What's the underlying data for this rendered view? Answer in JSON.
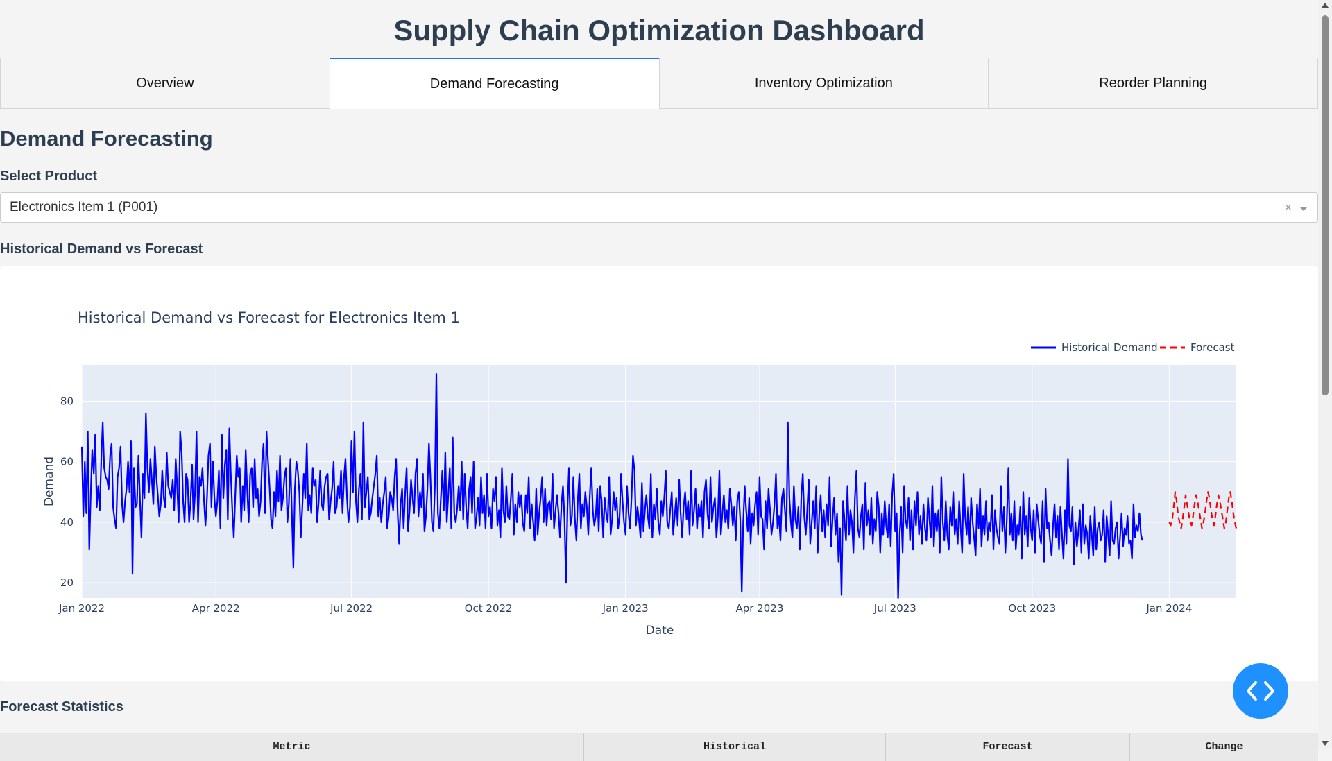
{
  "header": {
    "title": "Supply Chain Optimization Dashboard"
  },
  "tabs": [
    {
      "label": "Overview",
      "active": false
    },
    {
      "label": "Demand Forecasting",
      "active": true
    },
    {
      "label": "Inventory Optimization",
      "active": false
    },
    {
      "label": "Reorder Planning",
      "active": false
    }
  ],
  "main": {
    "section_title": "Demand Forecasting",
    "select_label": "Select Product",
    "product_select": {
      "value": "Electronics Item 1 (P001)",
      "clear_icon": "×",
      "dropdown_icon": "chevron-down-icon"
    },
    "chart_heading": "Historical Demand vs Forecast",
    "stats_heading": "Forecast Statistics",
    "stats_table": {
      "columns": [
        "Metric",
        "Historical",
        "Forecast",
        "Change"
      ]
    }
  },
  "fab": {
    "icon": "code-brackets-icon",
    "color": "#1e90ff"
  },
  "colors": {
    "accent": "#1975fa",
    "historical": "#0000ff",
    "forecast": "#ff0000",
    "plot_bg": "#e5ecf6"
  },
  "chart_data": {
    "type": "line",
    "title": "Historical Demand vs Forecast for Electronics Item 1",
    "xlabel": "Date",
    "ylabel": "Demand",
    "xlim": [
      "2022-01-01",
      "2024-02-15"
    ],
    "ylim": [
      15,
      92
    ],
    "x_ticks": [
      "Jan 2022",
      "Apr 2022",
      "Jul 2022",
      "Oct 2022",
      "Jan 2023",
      "Apr 2023",
      "Jul 2023",
      "Oct 2023",
      "Jan 2024"
    ],
    "y_ticks": [
      20,
      40,
      60,
      80
    ],
    "grid": true,
    "legend": "top-right",
    "series": [
      {
        "name": "Historical Demand",
        "style": "solid",
        "x_start": "2022-01-01",
        "x_end": "2023-12-31",
        "frequency": "daily",
        "values": [
          65,
          42,
          60,
          43,
          70,
          31,
          50,
          64,
          56,
          69,
          45,
          52,
          44,
          60,
          73,
          58,
          55,
          54,
          51,
          62,
          66,
          45,
          41,
          38,
          55,
          58,
          65,
          46,
          40,
          47,
          51,
          60,
          50,
          67,
          23,
          58,
          45,
          46,
          62,
          48,
          35,
          56,
          48,
          76,
          58,
          50,
          61,
          54,
          46,
          65,
          55,
          49,
          42,
          46,
          57,
          48,
          45,
          63,
          52,
          50,
          48,
          54,
          44,
          61,
          52,
          40,
          70,
          63,
          47,
          40,
          56,
          54,
          40,
          47,
          59,
          41,
          50,
          70,
          40,
          55,
          52,
          58,
          47,
          39,
          48,
          62,
          66,
          45,
          60,
          48,
          42,
          47,
          57,
          38,
          69,
          48,
          59,
          64,
          41,
          71,
          56,
          44,
          35,
          49,
          62,
          55,
          58,
          40,
          52,
          44,
          64,
          51,
          40,
          56,
          58,
          45,
          61,
          48,
          51,
          42,
          47,
          60,
          66,
          43,
          70,
          60,
          52,
          41,
          38,
          50,
          42,
          57,
          47,
          62,
          44,
          48,
          55,
          58,
          40,
          46,
          61,
          43,
          25,
          51,
          60,
          57,
          50,
          35,
          45,
          56,
          48,
          66,
          44,
          49,
          43,
          58,
          52,
          54,
          40,
          47,
          57,
          46,
          44,
          52,
          55,
          56,
          41,
          47,
          51,
          60,
          43,
          45,
          52,
          48,
          57,
          43,
          55,
          61,
          48,
          40,
          45,
          67,
          50,
          70,
          47,
          40,
          51,
          56,
          41,
          73,
          45,
          50,
          55,
          41,
          43,
          48,
          52,
          56,
          62,
          42,
          48,
          40,
          46,
          50,
          55,
          38,
          42,
          50,
          48,
          44,
          55,
          61,
          43,
          33,
          46,
          51,
          38,
          49,
          58,
          37,
          44,
          54,
          48,
          43,
          56,
          61,
          42,
          50,
          45,
          56,
          37,
          42,
          51,
          66,
          55,
          40,
          37,
          52,
          89,
          43,
          38,
          48,
          57,
          44,
          63,
          40,
          49,
          58,
          38,
          68,
          43,
          40,
          45,
          52,
          44,
          60,
          41,
          56,
          45,
          38,
          51,
          55,
          43,
          60,
          38,
          42,
          48,
          39,
          55,
          43,
          49,
          38,
          56,
          42,
          45,
          38,
          51,
          47,
          55,
          39,
          44,
          35,
          58,
          44,
          40,
          52,
          42,
          41,
          48,
          56,
          36,
          46,
          40,
          50,
          45,
          49,
          40,
          37,
          49,
          43,
          55,
          38,
          46,
          40,
          34,
          51,
          36,
          43,
          48,
          55,
          40,
          51,
          39,
          46,
          47,
          41,
          56,
          38,
          44,
          49,
          43,
          35,
          46,
          52,
          41,
          20,
          45,
          58,
          39,
          42,
          55,
          41,
          34,
          48,
          56,
          38,
          46,
          42,
          50,
          45,
          36,
          49,
          58,
          44,
          39,
          42,
          51,
          37,
          52,
          47,
          35,
          48,
          43,
          40,
          55,
          36,
          41,
          50,
          44,
          48,
          38,
          42,
          56,
          47,
          40,
          36,
          52,
          43,
          38,
          48,
          62,
          57,
          39,
          45,
          41,
          35,
          53,
          37,
          44,
          49,
          42,
          38,
          56,
          35,
          46,
          41,
          51,
          40,
          36,
          47,
          42,
          48,
          57,
          40,
          38,
          44,
          50,
          36,
          42,
          48,
          39,
          54,
          43,
          35,
          45,
          50,
          41,
          47,
          36,
          57,
          39,
          44,
          51,
          38,
          46,
          42,
          47,
          35,
          50,
          54,
          43,
          38,
          55,
          40,
          45,
          48,
          35,
          42,
          57,
          36,
          43,
          49,
          40,
          44,
          38,
          51,
          46,
          39,
          45,
          34,
          47,
          50,
          41,
          17,
          40,
          52,
          44,
          37,
          48,
          33,
          43,
          39,
          46,
          50,
          36,
          55,
          42,
          41,
          31,
          47,
          38,
          51,
          44,
          36,
          40,
          46,
          56,
          38,
          42,
          34,
          48,
          51,
          44,
          37,
          73,
          48,
          40,
          35,
          52,
          41,
          38,
          45,
          31,
          48,
          56,
          42,
          36,
          44,
          54,
          33,
          40,
          47,
          38,
          52,
          30,
          42,
          49,
          37,
          44,
          35,
          46,
          39,
          55,
          32,
          41,
          48,
          36,
          43,
          27,
          38,
          16,
          47,
          41,
          34,
          52,
          36,
          44,
          40,
          30,
          48,
          57,
          38,
          35,
          42,
          46,
          31,
          53,
          39,
          44,
          36,
          48,
          33,
          41,
          37,
          50,
          45,
          30,
          43,
          36,
          47,
          39,
          35,
          46,
          32,
          49,
          56,
          37,
          43,
          15,
          36,
          45,
          30,
          52,
          41,
          38,
          48,
          34,
          44,
          31,
          47,
          39,
          50,
          36,
          42,
          33,
          46,
          38,
          34,
          48,
          41,
          35,
          52,
          32,
          43,
          37,
          44,
          30,
          55,
          40,
          34,
          47,
          36,
          31,
          45,
          39,
          50,
          36,
          41,
          33,
          47,
          38,
          30,
          56,
          42,
          36,
          45,
          33,
          48,
          40,
          35,
          29,
          46,
          38,
          51,
          32,
          42,
          36,
          47,
          34,
          40,
          37,
          49,
          31,
          44,
          38,
          35,
          33,
          52,
          37,
          45,
          30,
          41,
          58,
          36,
          43,
          34,
          47,
          31,
          39,
          36,
          45,
          28,
          50,
          36,
          42,
          32,
          48,
          38,
          34,
          44,
          30,
          46,
          41,
          36,
          33,
          47,
          27,
          51,
          38,
          40,
          34,
          29,
          39,
          46,
          35,
          42,
          31,
          45,
          36,
          28,
          44,
          33,
          61,
          39,
          37,
          45,
          26,
          40,
          32,
          37,
          44,
          30,
          46,
          33,
          39,
          36,
          28,
          42,
          36,
          29,
          45,
          31,
          38,
          40,
          34,
          36,
          44,
          27,
          42,
          36,
          29,
          47,
          34,
          33,
          38,
          40,
          28,
          35,
          43,
          32,
          38,
          36,
          42,
          33,
          34,
          28,
          46,
          35,
          39,
          37,
          43,
          36,
          34
        ]
      },
      {
        "name": "Forecast",
        "style": "dashed",
        "x_start": "2024-01-01",
        "x_end": "2024-02-15",
        "frequency": "daily",
        "values": [
          40,
          39,
          41,
          45,
          50,
          47,
          42,
          40,
          38,
          41,
          45,
          49,
          46,
          43,
          40,
          39,
          42,
          46,
          49,
          47,
          44,
          41,
          38,
          40,
          43,
          47,
          50,
          48,
          44,
          41,
          39,
          42,
          46,
          49,
          47,
          44,
          41,
          38,
          40,
          44,
          48,
          50,
          47,
          43,
          40,
          38
        ]
      }
    ]
  }
}
